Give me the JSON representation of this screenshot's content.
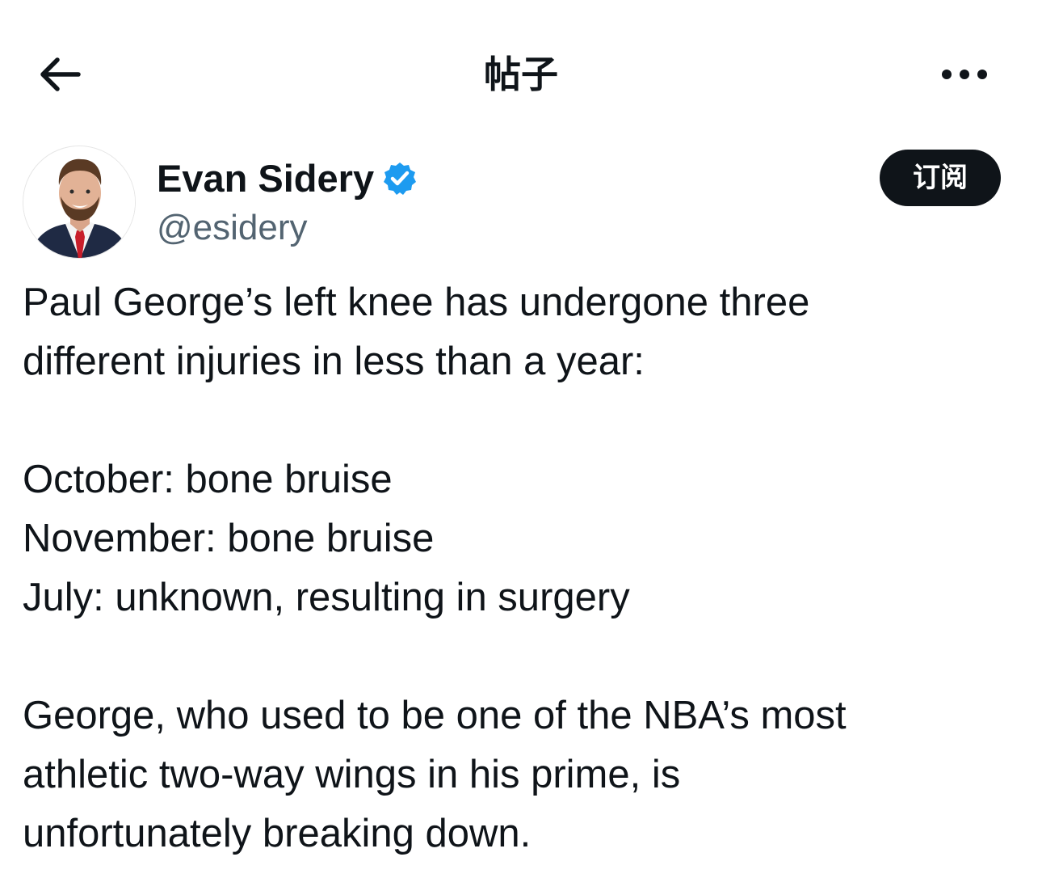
{
  "header": {
    "title": "帖子",
    "back_icon": "arrow-left-icon",
    "more_icon": "more-horizontal-icon"
  },
  "author": {
    "name": "Evan Sidery",
    "handle": "@esidery",
    "verified": true,
    "verified_color": "#1d9bf0",
    "avatar_icon": "avatar-photo"
  },
  "subscribe_button": {
    "label": "订阅",
    "background": "#0f1419"
  },
  "post": {
    "lines": [
      "Paul George’s left knee has undergone three",
      "different injuries in less than a year:",
      "",
      "October: bone bruise",
      "November: bone bruise",
      "July: unknown, resulting in surgery",
      "",
      "George, who used to be one of the NBA’s most",
      "athletic two-way wings in his prime, is",
      "unfortunately breaking down."
    ]
  },
  "colors": {
    "text_primary": "#0f1419",
    "text_secondary": "#536471",
    "background": "#ffffff"
  }
}
